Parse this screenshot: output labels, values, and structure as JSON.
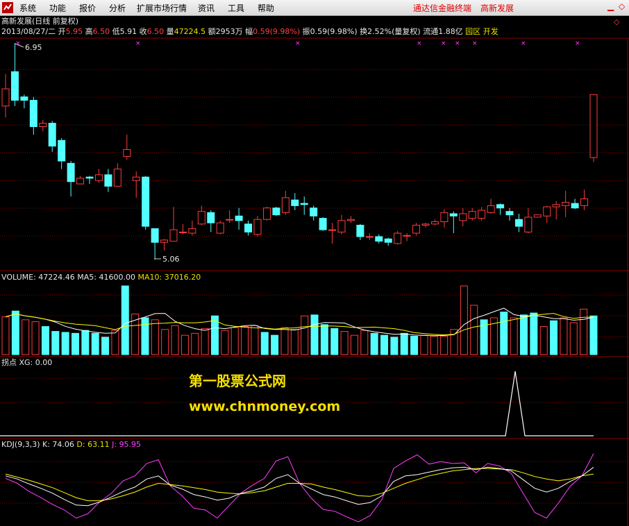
{
  "menu": {
    "items": [
      "系统",
      "功能",
      "报价",
      "分析",
      "扩展市场行情",
      "资讯",
      "工具",
      "帮助"
    ],
    "right_items": [
      "通达信金融终端",
      "高新发展"
    ]
  },
  "header": {
    "title": "高新发展(日线 前复权)",
    "date": "2013/08/27/二",
    "open_label": "开",
    "open": "5.95",
    "high_label": "高",
    "high": "6.50",
    "low_label": "低",
    "low": "5.91",
    "close_label": "收",
    "close": "6.50",
    "vol_label": "量",
    "vol": "47224.5",
    "amt_label": "额",
    "amt": "2953万",
    "chg_label": "幅",
    "chg": "0.59(9.98%)",
    "amp_label": "振",
    "amp": "0.59(9.98%)",
    "turn_label": "换",
    "turn": "2.52%(量复权)",
    "float_label": "流通",
    "float": "1.88亿",
    "tags": "园区 开发"
  },
  "price_panel": {
    "high_mark": "6.95",
    "low_mark": "5.06"
  },
  "volume_panel": {
    "label": "VOLUME:",
    "value": "47224.46",
    "ma5_label": "MA5:",
    "ma5": "41600.00",
    "ma10_label": "MA10:",
    "ma10": "37016.20"
  },
  "xg_panel": {
    "name": "拐点",
    "label": "XG:",
    "value": "0.00"
  },
  "kdj_panel": {
    "name": "KDJ(9,3,3)",
    "k_label": "K:",
    "k": "74.06",
    "d_label": "D:",
    "d": "63.11",
    "j_label": "J:",
    "j": "95.95"
  },
  "watermark": {
    "line1": "第一股票公式网",
    "line2": "www.chnmoney.com"
  },
  "colors": {
    "up": "#ff3c3c",
    "down": "#54ffff",
    "grid": "#8b0000",
    "ma5": "#ffffff",
    "ma10": "#ffff00",
    "j": "#ff40ff"
  },
  "chart_data": {
    "type": "candlestick",
    "candles": [
      [
        6.4,
        6.55,
        6.3,
        6.68
      ],
      [
        6.7,
        6.45,
        6.4,
        6.95
      ],
      [
        6.48,
        6.45,
        6.38,
        6.5
      ],
      [
        6.45,
        6.22,
        6.15,
        6.48
      ],
      [
        6.22,
        6.25,
        6.18,
        6.28
      ],
      [
        6.25,
        6.05,
        6.0,
        6.27
      ],
      [
        6.1,
        5.92,
        5.85,
        6.12
      ],
      [
        5.9,
        5.74,
        5.61,
        5.92
      ],
      [
        5.72,
        5.77,
        5.73,
        5.79
      ],
      [
        5.78,
        5.77,
        5.72,
        5.79
      ],
      [
        5.75,
        5.8,
        5.73,
        5.85
      ],
      [
        5.8,
        5.7,
        5.65,
        5.85
      ],
      [
        5.7,
        5.85,
        5.72,
        5.9
      ],
      [
        5.96,
        6.02,
        5.93,
        6.15
      ],
      [
        5.75,
        5.78,
        5.6,
        5.83
      ],
      [
        5.78,
        5.35,
        5.32,
        5.79
      ],
      [
        5.33,
        5.21,
        5.06,
        5.33
      ],
      [
        5.21,
        5.23,
        5.14,
        5.24
      ],
      [
        5.22,
        5.32,
        5.22,
        5.52
      ],
      [
        5.3,
        5.3,
        5.28,
        5.37
      ],
      [
        5.29,
        5.33,
        5.27,
        5.4
      ],
      [
        5.37,
        5.48,
        5.36,
        5.53
      ],
      [
        5.47,
        5.38,
        5.3,
        5.49
      ],
      [
        5.29,
        5.38,
        5.28,
        5.4
      ],
      [
        5.41,
        5.41,
        5.38,
        5.49
      ],
      [
        5.44,
        5.4,
        5.32,
        5.51
      ],
      [
        5.37,
        5.3,
        5.27,
        5.4
      ],
      [
        5.28,
        5.41,
        5.26,
        5.44
      ],
      [
        5.41,
        5.51,
        5.4,
        5.52
      ],
      [
        5.51,
        5.45,
        5.44,
        5.52
      ],
      [
        5.47,
        5.6,
        5.45,
        5.66
      ],
      [
        5.58,
        5.53,
        5.49,
        5.64
      ],
      [
        5.55,
        5.54,
        5.45,
        5.61
      ],
      [
        5.51,
        5.44,
        5.4,
        5.53
      ],
      [
        5.42,
        5.32,
        5.31,
        5.43
      ],
      [
        5.32,
        5.32,
        5.2,
        5.38
      ],
      [
        5.3,
        5.4,
        5.28,
        5.45
      ],
      [
        5.4,
        5.41,
        5.38,
        5.44
      ],
      [
        5.36,
        5.26,
        5.23,
        5.37
      ],
      [
        5.26,
        5.26,
        5.23,
        5.29
      ],
      [
        5.26,
        5.22,
        5.2,
        5.28
      ],
      [
        5.24,
        5.21,
        5.18,
        5.25
      ],
      [
        5.2,
        5.29,
        5.19,
        5.31
      ],
      [
        5.27,
        5.27,
        5.22,
        5.29
      ],
      [
        5.29,
        5.36,
        5.27,
        5.38
      ],
      [
        5.36,
        5.37,
        5.34,
        5.38
      ],
      [
        5.37,
        5.39,
        5.36,
        5.41
      ],
      [
        5.39,
        5.47,
        5.34,
        5.5
      ],
      [
        5.46,
        5.44,
        5.29,
        5.48
      ],
      [
        5.4,
        5.46,
        5.35,
        5.51
      ],
      [
        5.42,
        5.48,
        5.4,
        5.51
      ],
      [
        5.42,
        5.49,
        5.4,
        5.52
      ],
      [
        5.47,
        5.53,
        5.46,
        5.59
      ],
      [
        5.54,
        5.51,
        5.45,
        5.55
      ],
      [
        5.48,
        5.45,
        5.4,
        5.51
      ],
      [
        5.41,
        5.35,
        5.3,
        5.46
      ],
      [
        5.3,
        5.43,
        5.29,
        5.51
      ],
      [
        5.43,
        5.45,
        5.43,
        5.45
      ],
      [
        5.44,
        5.52,
        5.38,
        5.53
      ],
      [
        5.52,
        5.54,
        5.41,
        5.57
      ],
      [
        5.53,
        5.56,
        5.43,
        5.66
      ],
      [
        5.55,
        5.51,
        5.5,
        5.59
      ],
      [
        5.53,
        5.59,
        5.49,
        5.67
      ],
      [
        5.95,
        6.5,
        5.91,
        6.5
      ]
    ],
    "volume": [
      [
        39000,
        1
      ],
      [
        45000,
        0
      ],
      [
        36000,
        1
      ],
      [
        34000,
        1
      ],
      [
        29000,
        0
      ],
      [
        24000,
        0
      ],
      [
        23000,
        0
      ],
      [
        22000,
        0
      ],
      [
        25000,
        0
      ],
      [
        22000,
        0
      ],
      [
        18000,
        0
      ],
      [
        25000,
        1
      ],
      [
        71000,
        0
      ],
      [
        42000,
        1
      ],
      [
        38000,
        0
      ],
      [
        36000,
        1
      ],
      [
        26000,
        1
      ],
      [
        30000,
        1
      ],
      [
        20000,
        1
      ],
      [
        22000,
        1
      ],
      [
        27000,
        1
      ],
      [
        40000,
        0
      ],
      [
        25000,
        1
      ],
      [
        28000,
        1
      ],
      [
        29000,
        1
      ],
      [
        30000,
        1
      ],
      [
        23000,
        0
      ],
      [
        20000,
        0
      ],
      [
        28000,
        1
      ],
      [
        26000,
        1
      ],
      [
        40000,
        1
      ],
      [
        41000,
        0
      ],
      [
        31000,
        0
      ],
      [
        27000,
        0
      ],
      [
        24000,
        1
      ],
      [
        20000,
        1
      ],
      [
        25000,
        1
      ],
      [
        22000,
        0
      ],
      [
        20000,
        0
      ],
      [
        18000,
        0
      ],
      [
        22000,
        0
      ],
      [
        19000,
        0
      ],
      [
        20000,
        1
      ],
      [
        19000,
        1
      ],
      [
        19000,
        1
      ],
      [
        26000,
        1
      ],
      [
        71000,
        1
      ],
      [
        51000,
        1
      ],
      [
        36000,
        0
      ],
      [
        38000,
        1
      ],
      [
        44000,
        0
      ],
      [
        38000,
        1
      ],
      [
        41000,
        0
      ],
      [
        43000,
        0
      ],
      [
        29000,
        1
      ],
      [
        35000,
        0
      ],
      [
        38000,
        1
      ],
      [
        33000,
        1
      ],
      [
        47000,
        1
      ],
      [
        40000,
        0
      ]
    ],
    "xg_peak_index": 52,
    "k": [
      60,
      55,
      47,
      40,
      32,
      22,
      13,
      12,
      18,
      26,
      35,
      42,
      55,
      60,
      45,
      39,
      30,
      26,
      21,
      24,
      32,
      36,
      42,
      56,
      62,
      48,
      39,
      30,
      26,
      20,
      14,
      17,
      28,
      51,
      60,
      62,
      66,
      70,
      73,
      74,
      70,
      74,
      72,
      68,
      54,
      40,
      34,
      40,
      51,
      60,
      74
    ],
    "d": [
      63,
      58,
      53,
      47,
      41,
      33,
      25,
      20,
      20,
      23,
      28,
      34,
      42,
      48,
      46,
      44,
      41,
      38,
      34,
      32,
      31,
      33,
      36,
      42,
      48,
      48,
      47,
      42,
      38,
      33,
      28,
      27,
      32,
      40,
      48,
      54,
      60,
      64,
      68,
      70,
      72,
      72,
      71,
      70,
      65,
      59,
      55,
      52,
      55,
      60,
      63
    ],
    "j": [
      56,
      48,
      35,
      25,
      14,
      5,
      -8,
      -1,
      18,
      32,
      52,
      60,
      80,
      86,
      44,
      28,
      8,
      5,
      -8,
      12,
      32,
      45,
      56,
      84,
      91,
      48,
      24,
      6,
      3,
      -6,
      -14,
      -4,
      22,
      72,
      84,
      94,
      79,
      83,
      80,
      81,
      65,
      80,
      76,
      64,
      32,
      1,
      -8,
      16,
      43,
      60,
      96
    ]
  }
}
